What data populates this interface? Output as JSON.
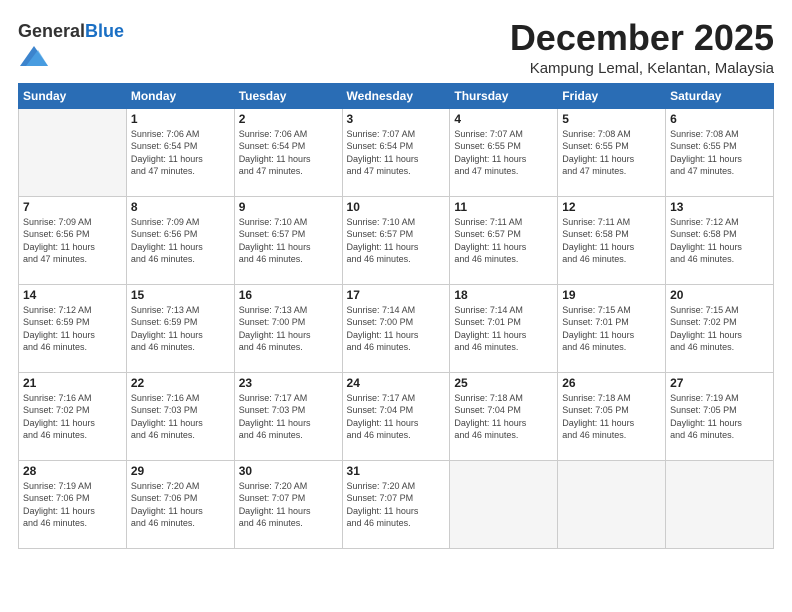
{
  "logo": {
    "general": "General",
    "blue": "Blue"
  },
  "header": {
    "month": "December 2025",
    "location": "Kampung Lemal, Kelantan, Malaysia"
  },
  "days_of_week": [
    "Sunday",
    "Monday",
    "Tuesday",
    "Wednesday",
    "Thursday",
    "Friday",
    "Saturday"
  ],
  "weeks": [
    [
      {
        "day": "",
        "info": ""
      },
      {
        "day": "1",
        "info": "Sunrise: 7:06 AM\nSunset: 6:54 PM\nDaylight: 11 hours\nand 47 minutes."
      },
      {
        "day": "2",
        "info": "Sunrise: 7:06 AM\nSunset: 6:54 PM\nDaylight: 11 hours\nand 47 minutes."
      },
      {
        "day": "3",
        "info": "Sunrise: 7:07 AM\nSunset: 6:54 PM\nDaylight: 11 hours\nand 47 minutes."
      },
      {
        "day": "4",
        "info": "Sunrise: 7:07 AM\nSunset: 6:55 PM\nDaylight: 11 hours\nand 47 minutes."
      },
      {
        "day": "5",
        "info": "Sunrise: 7:08 AM\nSunset: 6:55 PM\nDaylight: 11 hours\nand 47 minutes."
      },
      {
        "day": "6",
        "info": "Sunrise: 7:08 AM\nSunset: 6:55 PM\nDaylight: 11 hours\nand 47 minutes."
      }
    ],
    [
      {
        "day": "7",
        "info": "Sunrise: 7:09 AM\nSunset: 6:56 PM\nDaylight: 11 hours\nand 47 minutes."
      },
      {
        "day": "8",
        "info": "Sunrise: 7:09 AM\nSunset: 6:56 PM\nDaylight: 11 hours\nand 46 minutes."
      },
      {
        "day": "9",
        "info": "Sunrise: 7:10 AM\nSunset: 6:57 PM\nDaylight: 11 hours\nand 46 minutes."
      },
      {
        "day": "10",
        "info": "Sunrise: 7:10 AM\nSunset: 6:57 PM\nDaylight: 11 hours\nand 46 minutes."
      },
      {
        "day": "11",
        "info": "Sunrise: 7:11 AM\nSunset: 6:57 PM\nDaylight: 11 hours\nand 46 minutes."
      },
      {
        "day": "12",
        "info": "Sunrise: 7:11 AM\nSunset: 6:58 PM\nDaylight: 11 hours\nand 46 minutes."
      },
      {
        "day": "13",
        "info": "Sunrise: 7:12 AM\nSunset: 6:58 PM\nDaylight: 11 hours\nand 46 minutes."
      }
    ],
    [
      {
        "day": "14",
        "info": "Sunrise: 7:12 AM\nSunset: 6:59 PM\nDaylight: 11 hours\nand 46 minutes."
      },
      {
        "day": "15",
        "info": "Sunrise: 7:13 AM\nSunset: 6:59 PM\nDaylight: 11 hours\nand 46 minutes."
      },
      {
        "day": "16",
        "info": "Sunrise: 7:13 AM\nSunset: 7:00 PM\nDaylight: 11 hours\nand 46 minutes."
      },
      {
        "day": "17",
        "info": "Sunrise: 7:14 AM\nSunset: 7:00 PM\nDaylight: 11 hours\nand 46 minutes."
      },
      {
        "day": "18",
        "info": "Sunrise: 7:14 AM\nSunset: 7:01 PM\nDaylight: 11 hours\nand 46 minutes."
      },
      {
        "day": "19",
        "info": "Sunrise: 7:15 AM\nSunset: 7:01 PM\nDaylight: 11 hours\nand 46 minutes."
      },
      {
        "day": "20",
        "info": "Sunrise: 7:15 AM\nSunset: 7:02 PM\nDaylight: 11 hours\nand 46 minutes."
      }
    ],
    [
      {
        "day": "21",
        "info": "Sunrise: 7:16 AM\nSunset: 7:02 PM\nDaylight: 11 hours\nand 46 minutes."
      },
      {
        "day": "22",
        "info": "Sunrise: 7:16 AM\nSunset: 7:03 PM\nDaylight: 11 hours\nand 46 minutes."
      },
      {
        "day": "23",
        "info": "Sunrise: 7:17 AM\nSunset: 7:03 PM\nDaylight: 11 hours\nand 46 minutes."
      },
      {
        "day": "24",
        "info": "Sunrise: 7:17 AM\nSunset: 7:04 PM\nDaylight: 11 hours\nand 46 minutes."
      },
      {
        "day": "25",
        "info": "Sunrise: 7:18 AM\nSunset: 7:04 PM\nDaylight: 11 hours\nand 46 minutes."
      },
      {
        "day": "26",
        "info": "Sunrise: 7:18 AM\nSunset: 7:05 PM\nDaylight: 11 hours\nand 46 minutes."
      },
      {
        "day": "27",
        "info": "Sunrise: 7:19 AM\nSunset: 7:05 PM\nDaylight: 11 hours\nand 46 minutes."
      }
    ],
    [
      {
        "day": "28",
        "info": "Sunrise: 7:19 AM\nSunset: 7:06 PM\nDaylight: 11 hours\nand 46 minutes."
      },
      {
        "day": "29",
        "info": "Sunrise: 7:20 AM\nSunset: 7:06 PM\nDaylight: 11 hours\nand 46 minutes."
      },
      {
        "day": "30",
        "info": "Sunrise: 7:20 AM\nSunset: 7:07 PM\nDaylight: 11 hours\nand 46 minutes."
      },
      {
        "day": "31",
        "info": "Sunrise: 7:20 AM\nSunset: 7:07 PM\nDaylight: 11 hours\nand 46 minutes."
      },
      {
        "day": "",
        "info": ""
      },
      {
        "day": "",
        "info": ""
      },
      {
        "day": "",
        "info": ""
      }
    ]
  ]
}
